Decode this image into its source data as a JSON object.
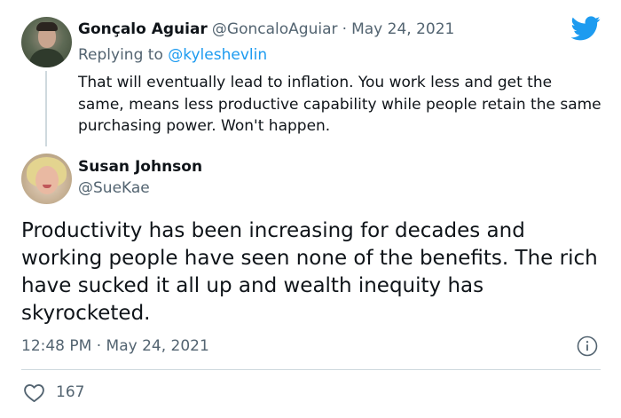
{
  "parent_tweet": {
    "name": "Gonçalo Aguiar",
    "handle": "@GoncaloAguiar",
    "separator": "·",
    "date": "May 24, 2021",
    "replying_prefix": "Replying to",
    "replying_to": "@kyleshevlin",
    "text": "That will eventually lead to inflation. You work less and get the same, means less productive capability while people retain the same purchasing power. Won't happen."
  },
  "main_tweet": {
    "name": "Susan Johnson",
    "handle": "@SueKae",
    "text": "Productivity has been increasing for decades and working people have seen none of the benefits. The rich have sucked it all up and wealth inequity has skyrocketed.",
    "time": "12:48 PM",
    "separator": "·",
    "date": "May 24, 2021",
    "likes": "167"
  },
  "icons": {
    "brand": "twitter-bird-icon",
    "info": "info-icon",
    "like": "heart-icon"
  },
  "colors": {
    "brand_blue": "#1d9bf0",
    "text_primary": "#0f1419",
    "text_muted": "#536471",
    "divider": "#cfd9de"
  }
}
